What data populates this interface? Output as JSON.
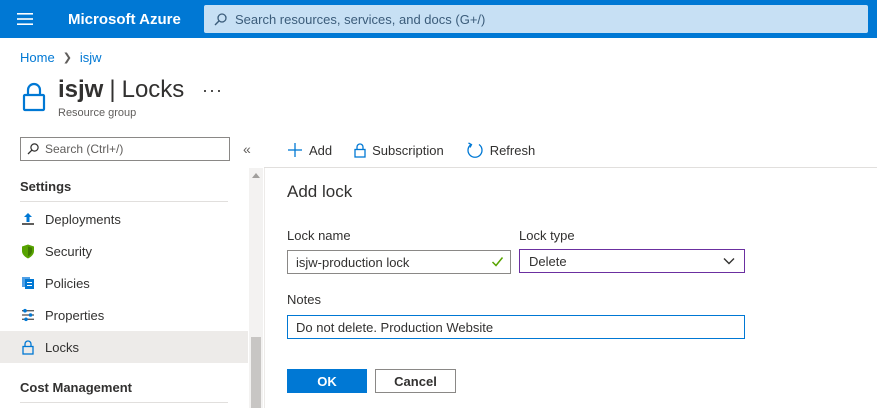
{
  "topbar": {
    "brand": "Microsoft Azure",
    "search_placeholder": "Search resources, services, and docs (G+/)",
    "background_color": "#0078d4"
  },
  "breadcrumb": {
    "items": [
      "Home",
      "isjw"
    ]
  },
  "header": {
    "resource_name": "isjw",
    "separator": "|",
    "page_name": "Locks",
    "subtitle": "Resource group",
    "more_label": "···"
  },
  "sidebar": {
    "search_placeholder": "Search (Ctrl+/)",
    "collapse_label": "«",
    "sections": [
      {
        "title": "Settings",
        "items": [
          {
            "label": "Deployments",
            "icon": "deployments-icon"
          },
          {
            "label": "Security",
            "icon": "shield-icon"
          },
          {
            "label": "Policies",
            "icon": "policies-icon"
          },
          {
            "label": "Properties",
            "icon": "properties-icon"
          },
          {
            "label": "Locks",
            "icon": "lock-icon",
            "active": true
          }
        ]
      },
      {
        "title": "Cost Management",
        "items": []
      }
    ]
  },
  "toolbar": {
    "add_label": "Add",
    "subscription_label": "Subscription",
    "refresh_label": "Refresh"
  },
  "add_lock": {
    "title": "Add lock",
    "lock_name_label": "Lock name",
    "lock_name_value": "isjw-production lock",
    "lock_type_label": "Lock type",
    "lock_type_value": "Delete",
    "notes_label": "Notes",
    "notes_value": "Do not delete. Production Website",
    "ok_label": "OK",
    "cancel_label": "Cancel",
    "accent_color": "#0078d4",
    "valid_color": "#57a300"
  }
}
